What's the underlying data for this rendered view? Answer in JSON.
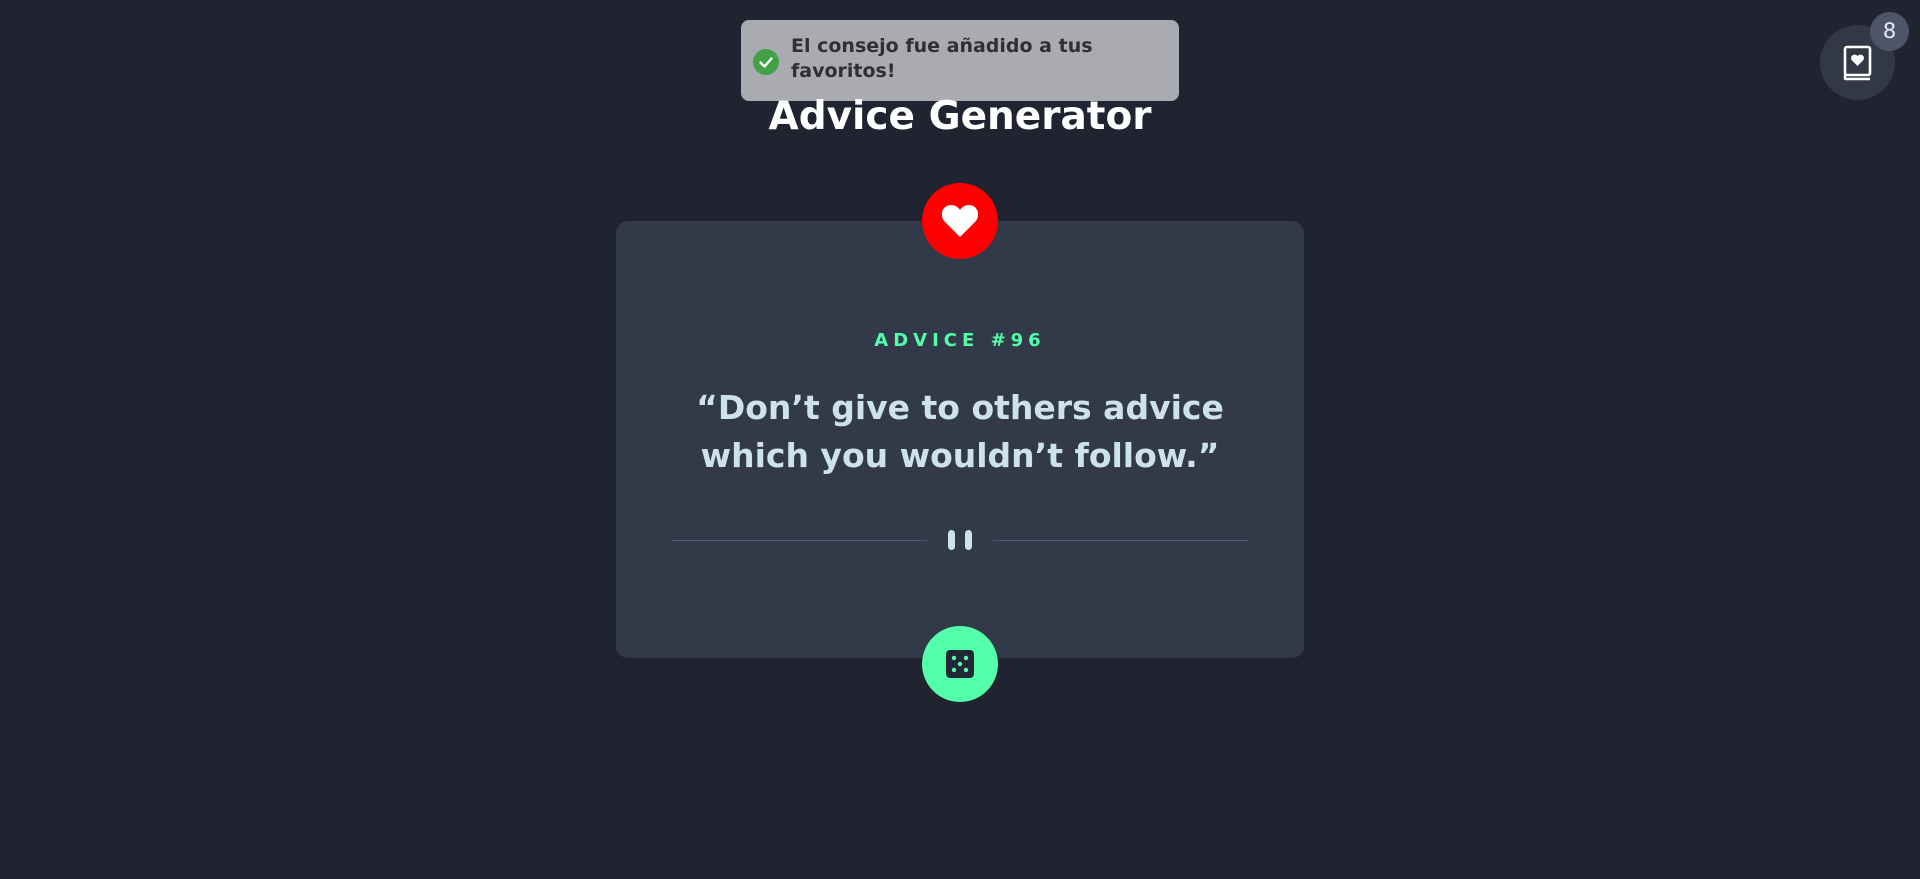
{
  "toast": {
    "message": "El consejo fue añadido a tus favoritos!",
    "icon": "check-circle-icon",
    "status_color": "#43a047"
  },
  "header": {
    "title": "Advice Generator"
  },
  "favorites": {
    "icon": "favorites-book-icon",
    "count": "8"
  },
  "card": {
    "favorite_icon": "heart-icon",
    "favorite_color": "#ff0000",
    "label": "ADVICE #96",
    "advice": "“Don’t give to others advice which you wouldn’t follow.”",
    "divider_icon": "pause-icon",
    "generate_icon": "dice-icon",
    "accent_color": "#53ffaa"
  }
}
